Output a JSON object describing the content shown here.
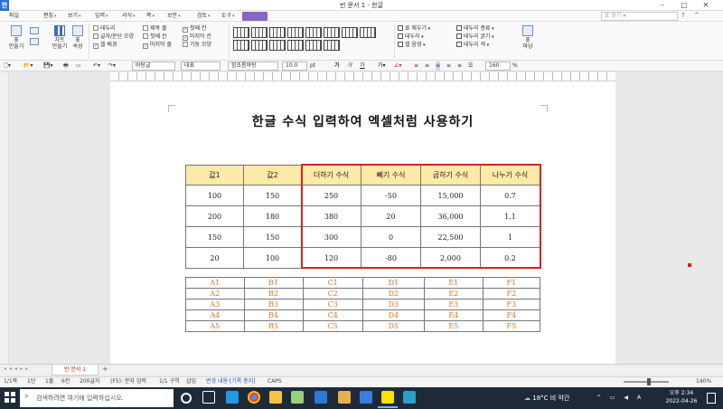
{
  "window": {
    "title": "빈 문서 1 - 한글",
    "app_icon": "한"
  },
  "menu": [
    {
      "label": "파일",
      "dd": false
    },
    {
      "label": "편집",
      "dd": true
    },
    {
      "label": "보기",
      "dd": true
    },
    {
      "label": "입력",
      "dd": true
    },
    {
      "label": "서식",
      "dd": true
    },
    {
      "label": "쪽",
      "dd": true
    },
    {
      "label": "보안",
      "dd": true
    },
    {
      "label": "검토",
      "dd": true
    },
    {
      "label": "도구",
      "dd": true
    }
  ],
  "search_placeholder": "표 찾기 ▾",
  "ribbon": {
    "table_btn": "표\n만들기",
    "chart_btn": "차트\n만들기",
    "props_btn": "표\n속성",
    "checks_col1": [
      {
        "label": "테두리",
        "checked": false
      },
      {
        "label": "글자/문단 모양",
        "checked": false
      },
      {
        "label": "셀 배경",
        "checked": true
      }
    ],
    "checks_col2": [
      {
        "label": "제목 줄",
        "checked": false
      },
      {
        "label": "첫째 칸",
        "checked": false
      },
      {
        "label": "마지막 줄",
        "checked": true
      }
    ],
    "checks_col3": [
      {
        "label": "첫째 칸",
        "checked": true
      },
      {
        "label": "마지막 칸",
        "checked": true
      },
      {
        "label": "기둥 모양",
        "checked": false
      }
    ],
    "right_items": [
      "표 채우기",
      "테두리",
      "셀 음영",
      "테두리 종류",
      "테두리 굵기",
      "테두리 색"
    ],
    "wrap_btn": "표\n마당"
  },
  "toolbar2": {
    "style": "바탕글",
    "lang": "대표",
    "font": "함초롬바탕",
    "size": "10.0",
    "unit": "pt",
    "zoom": "160",
    "zoom_unit": "%"
  },
  "doc": {
    "title": "한글 수식 입력하여 엑셀처럼 사용하기",
    "table1": {
      "headers": [
        "값1",
        "값2",
        "더하기 수식",
        "빼기 수식",
        "곱하기 수식",
        "나누기 수식"
      ],
      "rows": [
        [
          "100",
          "150",
          "250",
          "-50",
          "15,000",
          "0.7"
        ],
        [
          "200",
          "180",
          "380",
          "20",
          "36,000",
          "1.1"
        ],
        [
          "150",
          "150",
          "300",
          "0",
          "22,500",
          "1"
        ],
        [
          "20",
          "100",
          "120",
          "-80",
          "2,000",
          "0.2"
        ]
      ]
    },
    "table2": {
      "rows": [
        [
          "A1",
          "B1",
          "C1",
          "D1",
          "E1",
          "F1"
        ],
        [
          "A2",
          "B2",
          "C2",
          "D2",
          "E2",
          "F2"
        ],
        [
          "A3",
          "B3",
          "C3",
          "D3",
          "E3",
          "F3"
        ],
        [
          "A4",
          "B4",
          "C4",
          "D4",
          "E4",
          "F4"
        ],
        [
          "A5",
          "B5",
          "C5",
          "D5",
          "E5",
          "F5"
        ]
      ]
    }
  },
  "tabbar": {
    "doc_tab": "빈 문서 1"
  },
  "status": [
    "1/1쪽",
    "1단",
    "1줄",
    "6칸",
    "200글자",
    "(F5): 문자 입력",
    "1/1 구역",
    "삽입",
    "변경 내용 [기록 중지]",
    "CAPS"
  ],
  "status_zoom": "140%",
  "taskbar": {
    "search": "검색하려면 여기에 입력하십시오.",
    "weather": "18°C 비 약간",
    "time": "오후 2:34",
    "date": "2022-04-26"
  },
  "colors": {
    "header_fill": "#fde9a8",
    "highlight": "#d4241f",
    "ref_text": "#d9762b",
    "tab_accent": "#8a63c8"
  }
}
